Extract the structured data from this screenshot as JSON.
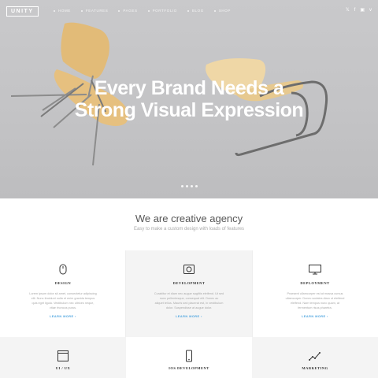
{
  "header": {
    "logo": "UNITY",
    "nav": [
      "Home",
      "Features",
      "Pages",
      "Portfolio",
      "Blog",
      "Shop"
    ],
    "social_icons": [
      "twitter-icon",
      "facebook-icon",
      "instagram-icon",
      "vine-icon"
    ]
  },
  "hero": {
    "title_line1": "Every Brand Needs a",
    "title_line2": "Strong Visual Expression",
    "slide_count": 4
  },
  "intro": {
    "title": "We are creative agency",
    "subtitle": "Easy to make a custom design with loads of features"
  },
  "features": [
    {
      "title": "Design",
      "icon": "mouse-icon",
      "text": [
        "Lorem ipsum dolor sit amet, consectetur adipiscing",
        "elit. Nunc tincidunt nulla et enim gravida tempus",
        "quis eget ligula. Vestibulum nec ultrices neque,",
        "vitae rhoncus purus."
      ],
      "link": "Learn more"
    },
    {
      "title": "Development",
      "icon": "camera-icon",
      "text": [
        "Curabitur et diam nec augue sagittis eleifend. Ut sed",
        "nunc pellentesque, consequat elit. Donec ac",
        "aliquet tellus. Mauris sed placerat est, in vestibulum",
        "dolor. Suspendisse at augue dolor."
      ],
      "link": "Learn more"
    },
    {
      "title": "Deployment",
      "icon": "monitor-icon",
      "text": [
        "Praesent ullamcorper est at massa cursus",
        "ullamcorper. Donec sodales diam ut eleifend",
        "eleifend. Nam tempus nunc quam, at",
        "fermentum risus pharetra."
      ],
      "link": "Learn more"
    },
    {
      "title": "UI / UX",
      "icon": "browser-icon"
    },
    {
      "title": "iOS Development",
      "icon": "phone-icon"
    },
    {
      "title": "Marketing",
      "icon": "chart-icon"
    }
  ],
  "colors": {
    "accent": "#4aa3df",
    "hero_bg": "#c6c6c8",
    "shaded_cell": "#f4f4f4"
  }
}
